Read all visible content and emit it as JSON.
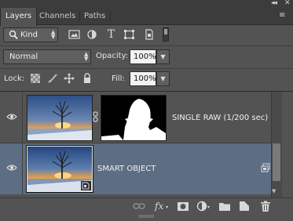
{
  "window": {
    "collapse_glyph": "◂◂",
    "close_glyph": "✕",
    "panel_menu_glyph": "≡"
  },
  "tabs": [
    {
      "label": "Layers",
      "active": true
    },
    {
      "label": "Channels",
      "active": false
    },
    {
      "label": "Paths",
      "active": false
    }
  ],
  "filter": {
    "kind_label": "Kind",
    "icons": [
      "pixel-filter-icon",
      "adjustment-filter-icon",
      "type-filter-icon",
      "shape-filter-icon",
      "smart-object-filter-icon"
    ],
    "type_glyph": "T",
    "filter_toggle": "off"
  },
  "blend": {
    "mode": "Normal",
    "opacity_label": "Opacity:",
    "opacity_value": "100%",
    "dropdown_glyph": "▼"
  },
  "lock": {
    "label": "Lock:",
    "icons": [
      "lock-transparent-pixels-icon",
      "lock-image-pixels-icon",
      "lock-position-icon",
      "lock-all-icon"
    ],
    "fill_label": "Fill:",
    "fill_value": "100%"
  },
  "layers": [
    {
      "name": "SINGLE RAW (1/200 sec)",
      "visible": true,
      "has_mask": true,
      "linked_mask": true,
      "selected": false
    },
    {
      "name": "SMART OBJECT",
      "visible": true,
      "smart_object": true,
      "selected": true
    }
  ],
  "bottom_icons": [
    "link-layers-icon",
    "fx-icon",
    "add-mask-icon",
    "adjustment-layer-icon",
    "new-group-icon",
    "new-layer-icon",
    "trash-icon"
  ],
  "fx_label": "fx",
  "colors": {
    "panel_bg": "#535353",
    "selected_row": "#5d6d82",
    "tab_bar": "#3c3c3c"
  }
}
